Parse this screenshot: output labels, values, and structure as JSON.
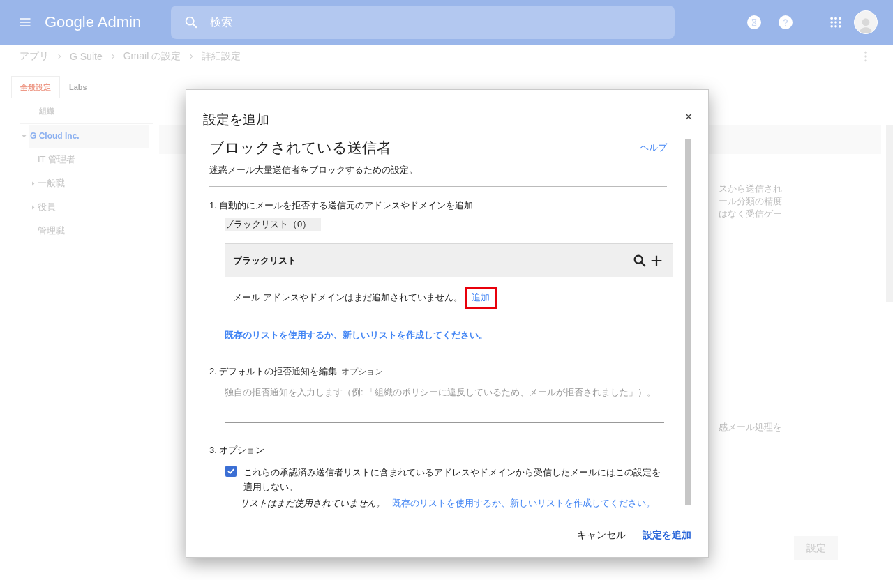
{
  "header": {
    "logo": "Google Admin",
    "search": {
      "placeholder": "検索"
    }
  },
  "breadcrumb": [
    "アプリ",
    "G Suite",
    "Gmail の設定",
    "詳細設定"
  ],
  "tabs": [
    {
      "label": "全般設定",
      "selected": true
    },
    {
      "label": "Labs",
      "selected": false
    }
  ],
  "org_tree": {
    "heading": "組織",
    "items": [
      {
        "label": "G Cloud Inc.",
        "selected": true,
        "expanded": true,
        "children": [
          {
            "label": "IT 管理者",
            "selected": false
          },
          {
            "label": "一般職",
            "selected": false,
            "expanded": false
          },
          {
            "label": "役員",
            "selected": false,
            "expanded": false
          },
          {
            "label": "管理職",
            "selected": false
          }
        ]
      }
    ]
  },
  "background_text": [
    "スから送信され",
    "ール分類の精度",
    "はなく受信ゲー",
    "感メール処理を"
  ],
  "save_button": "設定",
  "dialog": {
    "title": "設定を追加",
    "close": "×",
    "heading": "ブロックされている送信者",
    "help_link": "ヘルプ",
    "description": "迷惑メール大量送信者をブロックするための設定。",
    "sections": [
      {
        "kind": "list",
        "title": "1. 自動的にメールを拒否する送信元のアドレスやドメインを追加",
        "list_label": "ブラックリスト（0）",
        "table_title": "ブラックリスト",
        "empty_text": "メール アドレスやドメインはまだ追加されていません。",
        "add_link": {
          "label": "追加",
          "highlighted": true
        },
        "link": "既存のリストを使用するか、新しいリストを作成してください。"
      },
      {
        "kind": "textarea",
        "title": "2. デフォルトの拒否通知を編集",
        "note": "オプション",
        "placeholder": "独自の拒否通知を入力します（例: 「組織のポリシーに違反しているため、メールが拒否されました」）。"
      },
      {
        "kind": "options",
        "title": "3. オプション",
        "checkbox": {
          "label": "これらの承認済み送信者リストに含まれているアドレスやドメインから受信したメールにはこの設定を適用しない。",
          "checked": true
        },
        "status": "リストはまだ使用されていません。",
        "link": "既存のリストを使用するか、新しいリストを作成してください。"
      }
    ],
    "buttons": [
      {
        "label": "キャンセル",
        "kind": "text"
      },
      {
        "label": "設定を追加",
        "kind": "primary"
      }
    ]
  }
}
